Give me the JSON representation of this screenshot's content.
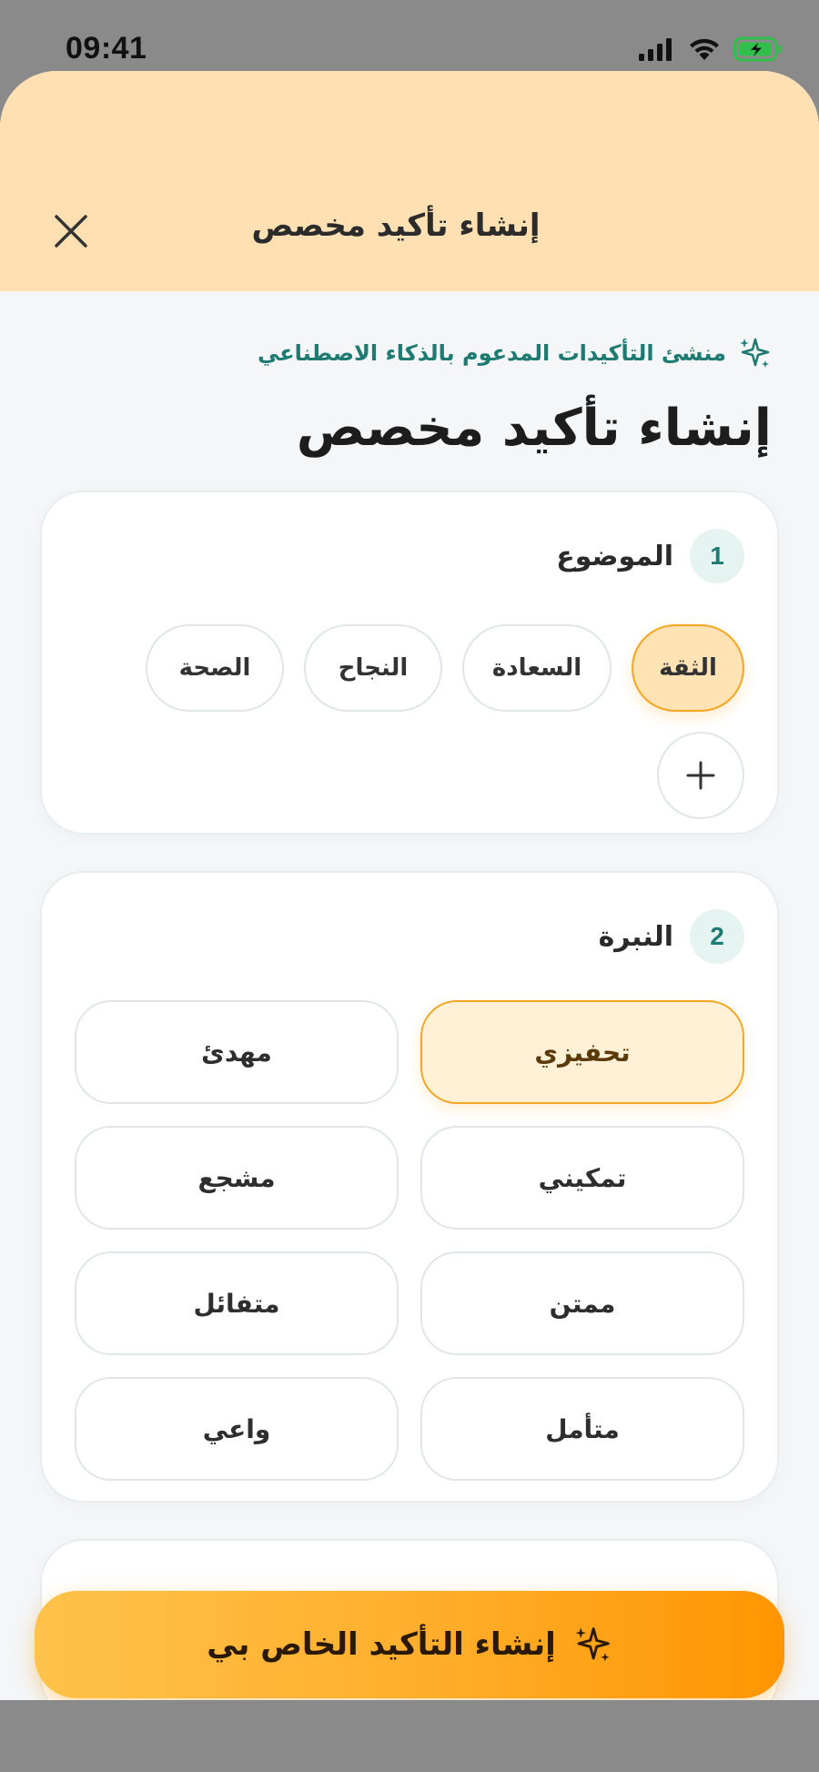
{
  "status_bar": {
    "time": "09:41"
  },
  "header": {
    "title": "إنشاء تأكيد مخصص",
    "close_icon": "close-icon"
  },
  "ai_tag": {
    "text": "منشئ التأكيدات المدعوم بالذكاء الاصطناعي",
    "icon": "sparkles-icon"
  },
  "page_title": "إنشاء تأكيد مخصص",
  "topic": {
    "step": "1",
    "label": "الموضوع",
    "chips": [
      {
        "label": "الثقة",
        "selected": true
      },
      {
        "label": "السعادة",
        "selected": false
      },
      {
        "label": "النجاح",
        "selected": false
      },
      {
        "label": "الصحة",
        "selected": false
      }
    ],
    "add_icon": "plus-icon"
  },
  "tone": {
    "step": "2",
    "label": "النبرة",
    "options": [
      {
        "label": "تحفيزي",
        "selected": true
      },
      {
        "label": "مهدئ",
        "selected": false
      },
      {
        "label": "تمكيني",
        "selected": false
      },
      {
        "label": "مشجع",
        "selected": false
      },
      {
        "label": "ممتن",
        "selected": false
      },
      {
        "label": "متفائل",
        "selected": false
      },
      {
        "label": "متأمل",
        "selected": false
      },
      {
        "label": "واعي",
        "selected": false
      }
    ]
  },
  "cta": {
    "label": "إنشاء التأكيد الخاص بي",
    "icon": "sparkles-icon"
  },
  "colors": {
    "accent": "#f5a623",
    "header_bg": "#ffe0b2",
    "teal": "#1f7a72"
  }
}
